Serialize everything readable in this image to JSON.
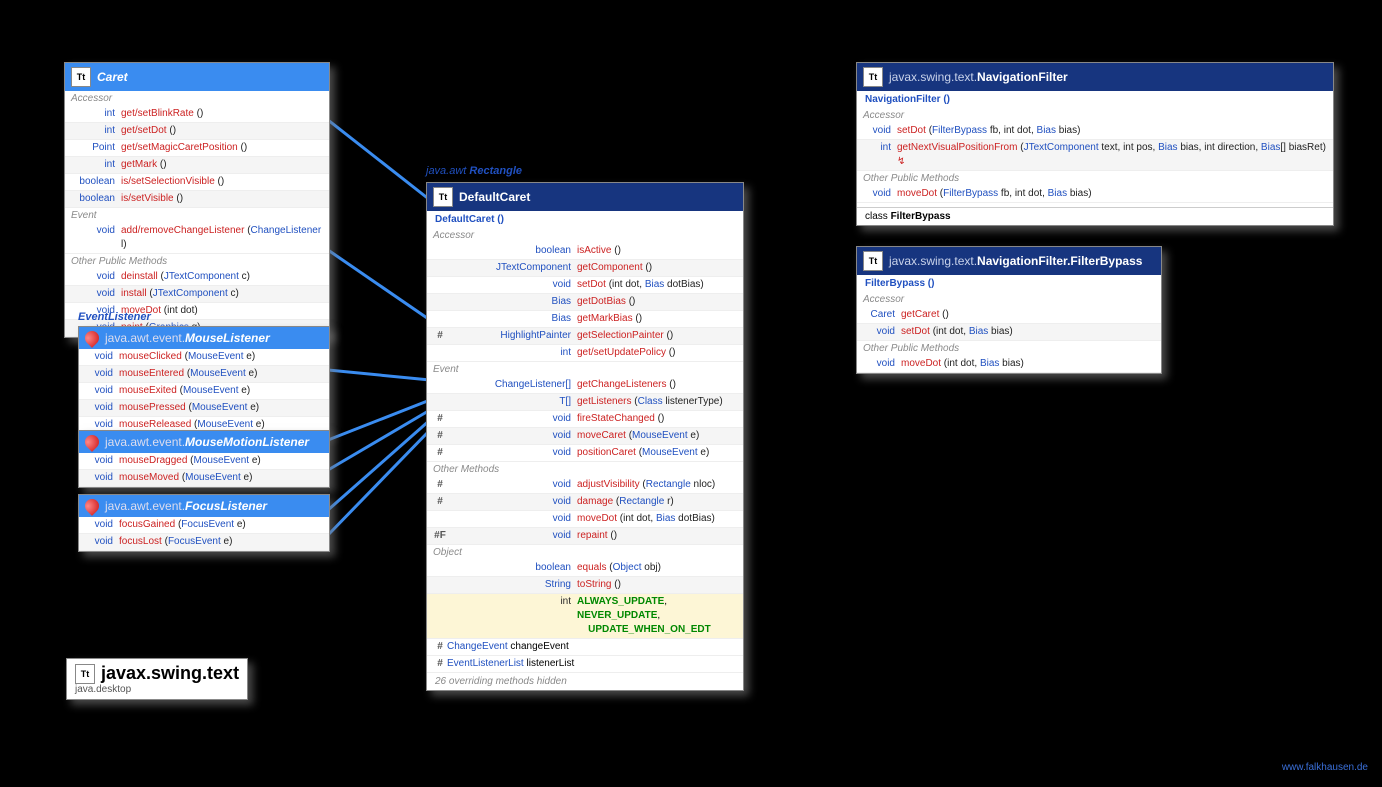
{
  "labels": {
    "eventlistener": "EventListener",
    "rectangle_pkg": "java.awt",
    "rectangle": "Rectangle",
    "footer": "www.falkhausen.de"
  },
  "package": {
    "name": "javax.swing.text",
    "module": "java.desktop"
  },
  "caret": {
    "title": "Caret",
    "sections": {
      "accessor": "Accessor",
      "event": "Event",
      "other": "Other Public Methods"
    },
    "rows": [
      {
        "ret": "int",
        "nm": "get/setBlinkRate",
        "args": "()"
      },
      {
        "ret": "int",
        "nm": "get/setDot",
        "args": "()"
      },
      {
        "ret": "Point",
        "nm": "get/setMagicCaretPosition",
        "args": "()"
      },
      {
        "ret": "int",
        "nm": "getMark",
        "args": "()"
      },
      {
        "ret": "boolean",
        "nm": "is/setSelectionVisible",
        "args": "()"
      },
      {
        "ret": "boolean",
        "nm": "is/setVisible",
        "args": "()"
      },
      {
        "ret": "void",
        "nm": "add/removeChangeListener",
        "args": "(",
        "t1": "ChangeListener",
        "a2": " l)"
      },
      {
        "ret": "void",
        "nm": "deinstall",
        "args": "(",
        "t1": "JTextComponent",
        "a2": " c)"
      },
      {
        "ret": "void",
        "nm": "install",
        "args": "(",
        "t1": "JTextComponent",
        "a2": " c)"
      },
      {
        "ret": "void",
        "nm": "moveDot",
        "args": "(int dot)"
      },
      {
        "ret": "void",
        "nm": "paint",
        "args": "(",
        "t1": "Graphics",
        "a2": " g)"
      }
    ]
  },
  "mouselistener": {
    "pkg": "java.awt.event.",
    "title": "MouseListener",
    "rows": [
      {
        "ret": "void",
        "nm": "mouseClicked",
        "args": "(",
        "t1": "MouseEvent",
        "a2": " e)"
      },
      {
        "ret": "void",
        "nm": "mouseEntered",
        "args": "(",
        "t1": "MouseEvent",
        "a2": " e)"
      },
      {
        "ret": "void",
        "nm": "mouseExited",
        "args": "(",
        "t1": "MouseEvent",
        "a2": " e)"
      },
      {
        "ret": "void",
        "nm": "mousePressed",
        "args": "(",
        "t1": "MouseEvent",
        "a2": " e)"
      },
      {
        "ret": "void",
        "nm": "mouseReleased",
        "args": "(",
        "t1": "MouseEvent",
        "a2": " e)"
      }
    ]
  },
  "mousemotion": {
    "pkg": "java.awt.event.",
    "title": "MouseMotionListener",
    "rows": [
      {
        "ret": "void",
        "nm": "mouseDragged",
        "args": "(",
        "t1": "MouseEvent",
        "a2": " e)"
      },
      {
        "ret": "void",
        "nm": "mouseMoved",
        "args": "(",
        "t1": "MouseEvent",
        "a2": " e)"
      }
    ]
  },
  "focus": {
    "pkg": "java.awt.event.",
    "title": "FocusListener",
    "rows": [
      {
        "ret": "void",
        "nm": "focusGained",
        "args": "(",
        "t1": "FocusEvent",
        "a2": " e)"
      },
      {
        "ret": "void",
        "nm": "focusLost",
        "args": "(",
        "t1": "FocusEvent",
        "a2": " e)"
      }
    ]
  },
  "defaultcaret": {
    "title": "DefaultCaret",
    "ctor": "DefaultCaret ()",
    "sections": {
      "accessor": "Accessor",
      "event": "Event",
      "other": "Other Methods",
      "object": "Object"
    },
    "rows_acc": [
      {
        "sym": "",
        "ret": "boolean",
        "nm": "isActive",
        "args": "()"
      },
      {
        "sym": "",
        "ret": "JTextComponent",
        "nm": "getComponent",
        "args": "()"
      },
      {
        "sym": "",
        "ret": "void",
        "nm": "setDot",
        "args": "(int dot, ",
        "t1": "Bias",
        "a2": " dotBias)"
      },
      {
        "sym": "",
        "ret": "Bias",
        "nm": "getDotBias",
        "args": "()"
      },
      {
        "sym": "",
        "ret": "Bias",
        "nm": "getMarkBias",
        "args": "()"
      },
      {
        "sym": "#",
        "ret": "HighlightPainter",
        "nm": "getSelectionPainter",
        "args": "()"
      },
      {
        "sym": "",
        "ret": "int",
        "nm": "get/setUpdatePolicy",
        "args": "()"
      }
    ],
    "rows_evt": [
      {
        "sym": "",
        "ret": "ChangeListener[]",
        "nm": "getChangeListeners",
        "args": "()"
      },
      {
        "sym": "",
        "ret": "<T extends EventListener> T[]",
        "nm": "getListeners",
        "args": "(",
        "t1": "Class",
        "a2": "<T> listenerType)"
      },
      {
        "sym": "#",
        "ret": "void",
        "nm": "fireStateChanged",
        "args": "()"
      },
      {
        "sym": "#",
        "ret": "void",
        "nm": "moveCaret",
        "args": "(",
        "t1": "MouseEvent",
        "a2": " e)"
      },
      {
        "sym": "#",
        "ret": "void",
        "nm": "positionCaret",
        "args": "(",
        "t1": "MouseEvent",
        "a2": " e)"
      }
    ],
    "rows_oth": [
      {
        "sym": "#",
        "ret": "void",
        "nm": "adjustVisibility",
        "args": "(",
        "t1": "Rectangle",
        "a2": " nloc)"
      },
      {
        "sym": "#",
        "ret": "void",
        "nm": "damage",
        "args": "(",
        "t1": "Rectangle",
        "a2": " r)"
      },
      {
        "sym": "",
        "ret": "void",
        "nm": "moveDot",
        "args": "(int dot, ",
        "t1": "Bias",
        "a2": " dotBias)"
      },
      {
        "sym": "#F",
        "ret": "void",
        "nm": "repaint",
        "args": "()"
      }
    ],
    "rows_obj": [
      {
        "sym": "",
        "ret": "boolean",
        "nm": "equals",
        "args": "(",
        "t1": "Object",
        "a2": " obj)"
      },
      {
        "sym": "",
        "ret": "String",
        "nm": "toString",
        "args": "()"
      }
    ],
    "consts": {
      "ret": "int",
      "v1": "ALWAYS_UPDATE",
      "v2": "NEVER_UPDATE",
      "v3": "UPDATE_WHEN_ON_EDT"
    },
    "fields": [
      {
        "sym": "#",
        "ret": "ChangeEvent",
        "nm": "changeEvent"
      },
      {
        "sym": "#",
        "ret": "EventListenerList",
        "nm": "listenerList"
      }
    ],
    "hidden": "26 overriding methods hidden"
  },
  "navfilter": {
    "pkg": "javax.swing.text.",
    "title": "NavigationFilter",
    "ctor": "NavigationFilter ()",
    "sections": {
      "accessor": "Accessor",
      "other": "Other Public Methods"
    },
    "rows_acc": [
      {
        "ret": "void",
        "nm": "setDot",
        "args": "(",
        "t1": "FilterBypass",
        "a2": " fb, int dot, ",
        "t2": "Bias",
        "a3": " bias)"
      },
      {
        "ret": "int",
        "nm": "getNextVisualPositionFrom",
        "args": "(",
        "t1": "JTextComponent",
        "a2": " text, int pos, ",
        "t2": "Bias",
        "a3": " bias, int direction, ",
        "t3": "Bias",
        "a4": "[] biasRet) ",
        "thr": "↯"
      }
    ],
    "rows_oth": [
      {
        "ret": "void",
        "nm": "moveDot",
        "args": "(",
        "t1": "FilterBypass",
        "a2": " fb, int dot, ",
        "t2": "Bias",
        "a3": " bias)"
      }
    ],
    "inner_prefix": "class ",
    "inner": "FilterBypass"
  },
  "filterbypass": {
    "pkg": "javax.swing.text.",
    "title": "NavigationFilter.FilterBypass",
    "ctor": "FilterBypass ()",
    "sections": {
      "accessor": "Accessor",
      "other": "Other Public Methods"
    },
    "rows_acc": [
      {
        "ret": "Caret",
        "nm": "getCaret",
        "args": "()"
      },
      {
        "ret": "void",
        "nm": "setDot",
        "args": "(int dot, ",
        "t1": "Bias",
        "a2": " bias)"
      }
    ],
    "rows_oth": [
      {
        "ret": "void",
        "nm": "moveDot",
        "args": "(int dot, ",
        "t1": "Bias",
        "a2": " bias)"
      }
    ]
  }
}
